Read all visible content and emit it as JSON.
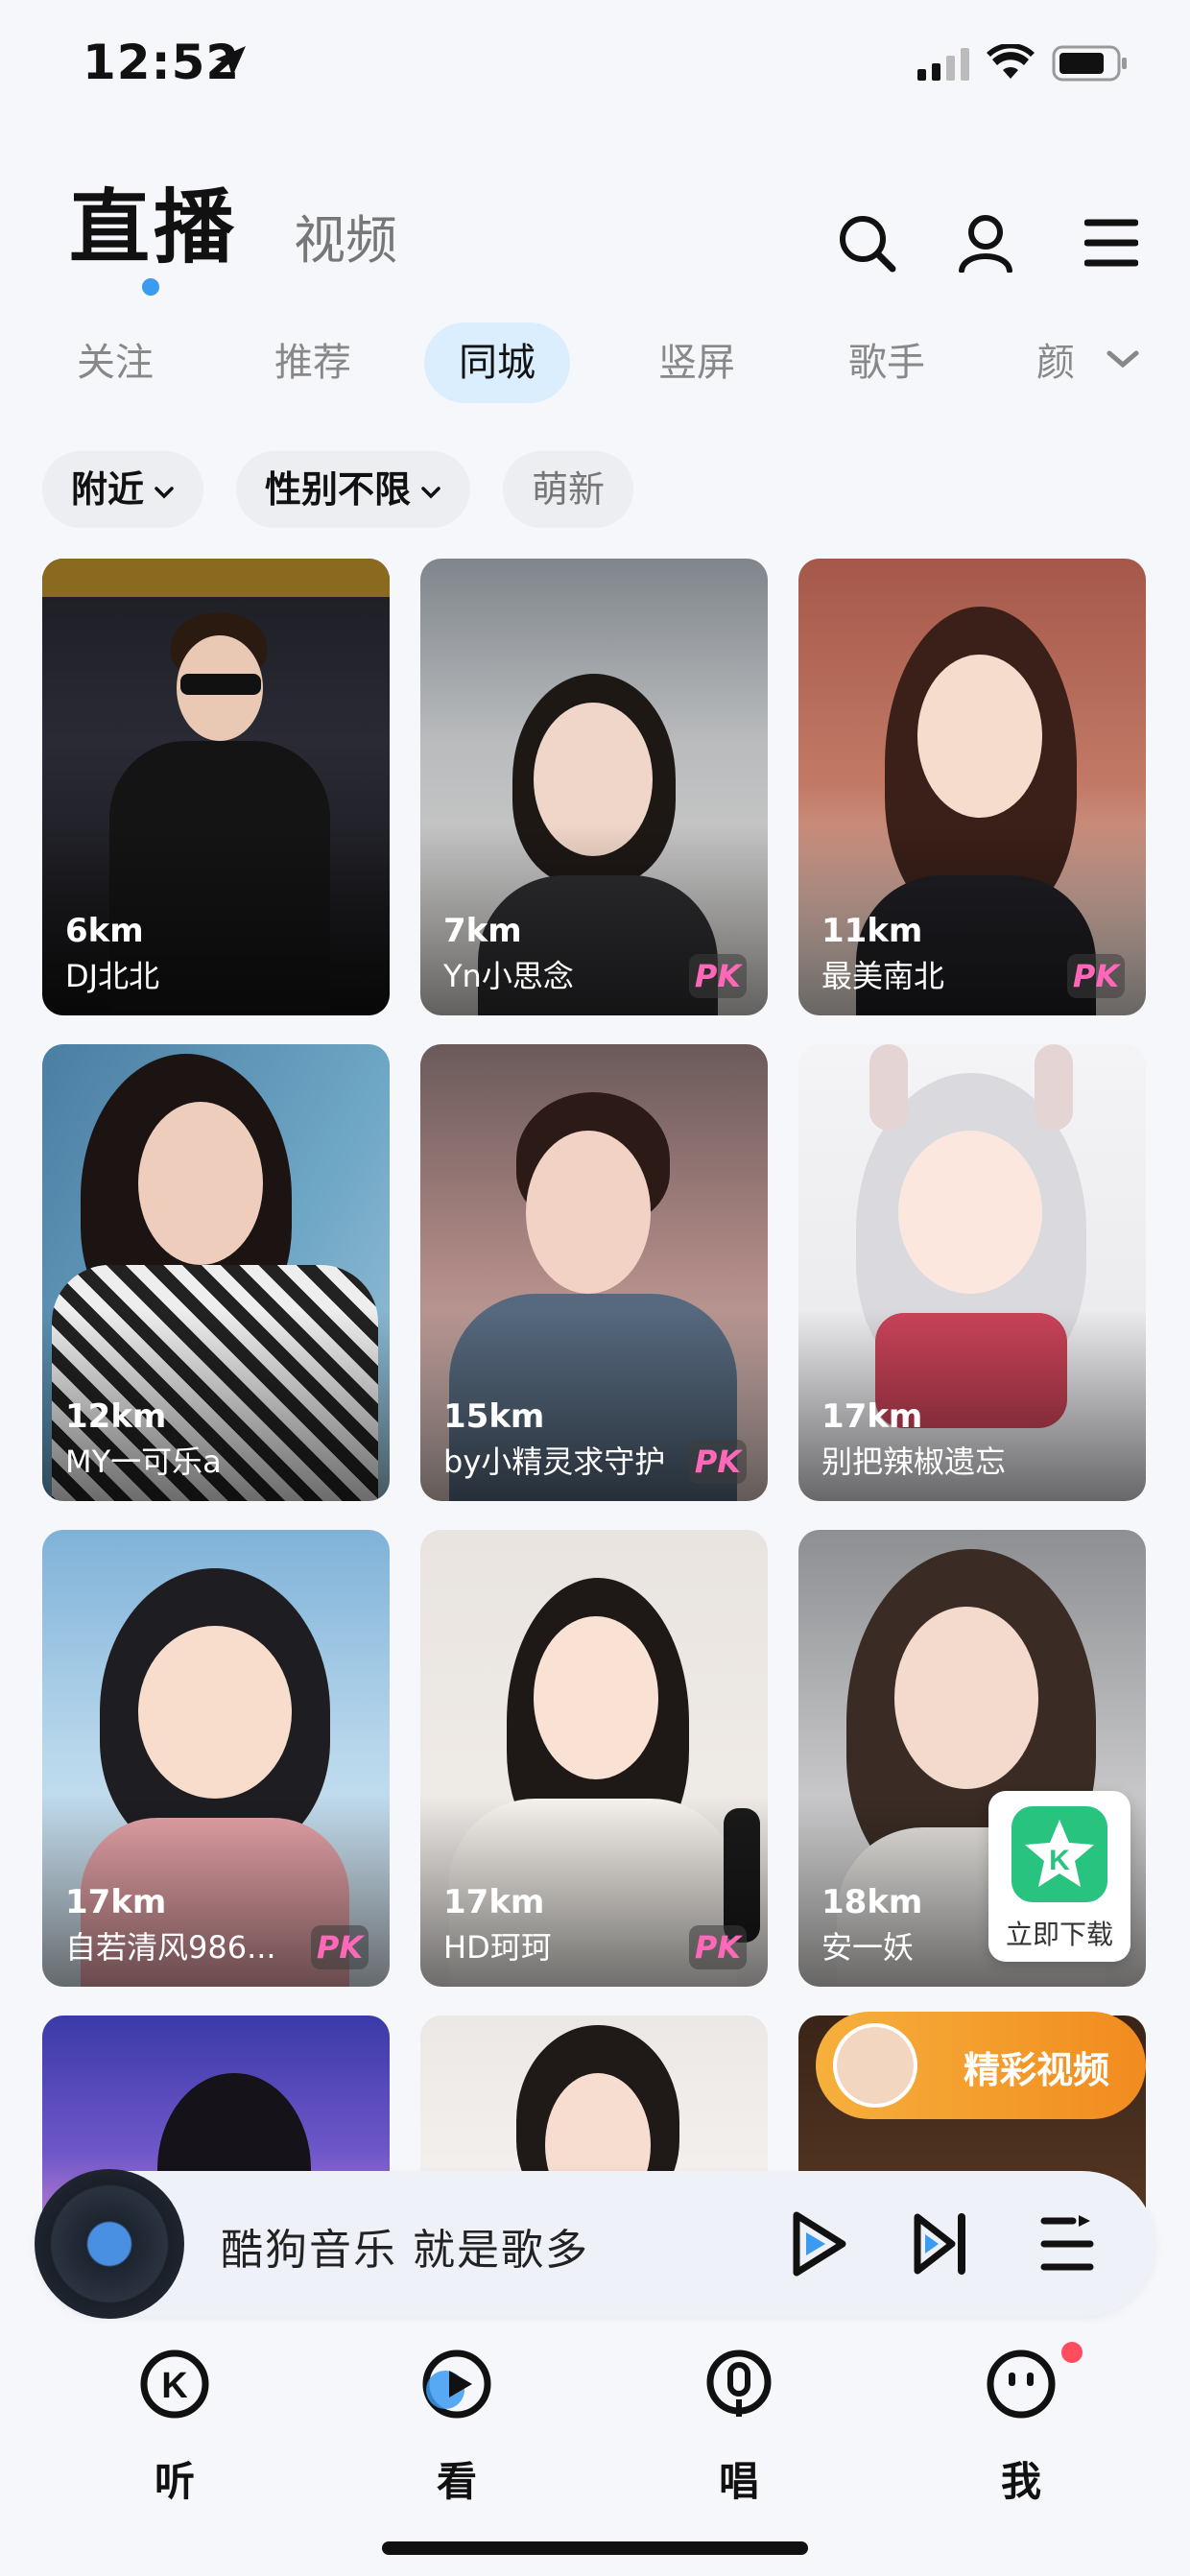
{
  "status_bar": {
    "time": "12:52"
  },
  "header": {
    "tab_live": "直播",
    "tab_video": "视频",
    "icons": [
      "search-icon",
      "user-icon",
      "menu-icon"
    ]
  },
  "categories": [
    "关注",
    "推荐",
    "同城",
    "竖屏",
    "歌手",
    "颜"
  ],
  "active_category": "同城",
  "filters": [
    {
      "label": "附近",
      "has_dropdown": true
    },
    {
      "label": "性别不限",
      "has_dropdown": true
    },
    {
      "label": "萌新",
      "has_dropdown": false
    }
  ],
  "streams": [
    {
      "distance": "6km",
      "name": "DJ北北",
      "pk": false
    },
    {
      "distance": "7km",
      "name": "Yn小思念",
      "pk": true
    },
    {
      "distance": "11km",
      "name": "最美南北",
      "pk": true
    },
    {
      "distance": "12km",
      "name": "MY一可乐a",
      "pk": false
    },
    {
      "distance": "15km",
      "name": "by小精灵求守护",
      "pk": true
    },
    {
      "distance": "17km",
      "name": "别把辣椒遗忘",
      "pk": false
    },
    {
      "distance": "17km",
      "name": "自若清风986...",
      "pk": true
    },
    {
      "distance": "17km",
      "name": "HD珂珂",
      "pk": true
    },
    {
      "distance": "18km",
      "name": "安一妖",
      "pk": false
    }
  ],
  "pk_label": "PK",
  "download_badge": {
    "label": "立即下载"
  },
  "promo": {
    "label": "精彩视频"
  },
  "player": {
    "text": "酷狗音乐  就是歌多"
  },
  "bottom_nav": [
    {
      "label": "听",
      "icon": "listen-icon"
    },
    {
      "label": "看",
      "icon": "watch-icon"
    },
    {
      "label": "唱",
      "icon": "sing-icon"
    },
    {
      "label": "我",
      "icon": "me-icon"
    }
  ],
  "colors": {
    "accent": "#3a9bf0",
    "active_tab_bg": "#dbeefe",
    "pk_pink": "#ff68b8",
    "promo_orange": "#f18b1f",
    "notification_red": "#ff4d5e"
  }
}
